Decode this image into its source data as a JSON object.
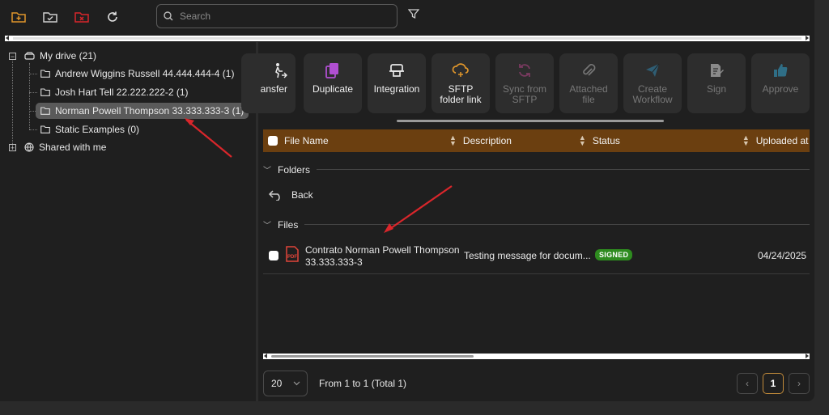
{
  "toolbar": {
    "icons": [
      "new-folder-icon",
      "folder-check-icon",
      "folder-x-icon",
      "refresh-icon"
    ],
    "search_placeholder": "Search",
    "filter_icon": "filter-icon"
  },
  "tree": {
    "root_label": "My drive (21)",
    "children": [
      {
        "label": "Andrew Wiggins Russell 44.444.444-4 (1)"
      },
      {
        "label": "Josh Hart Tell 22.222.222-2 (1)"
      },
      {
        "label": "Norman Powell Thompson 33.333.333-3 (1)",
        "selected": true
      },
      {
        "label": "Static Examples (0)"
      }
    ],
    "shared_label": "Shared with me"
  },
  "actions": [
    {
      "label": "ansfer",
      "icon": "transfer-icon",
      "disabled": false
    },
    {
      "label": "Duplicate",
      "icon": "duplicate-icon",
      "disabled": false
    },
    {
      "label": "Integration",
      "icon": "integration-icon",
      "disabled": false
    },
    {
      "label": "SFTP folder link",
      "icon": "sftp-link-icon",
      "disabled": false
    },
    {
      "label": "Sync from SFTP",
      "icon": "sync-icon",
      "disabled": true
    },
    {
      "label": "Attached file",
      "icon": "paperclip-icon",
      "disabled": true
    },
    {
      "label": "Create Workflow",
      "icon": "send-icon",
      "disabled": true
    },
    {
      "label": "Sign",
      "icon": "sign-icon",
      "disabled": true
    },
    {
      "label": "Approve",
      "icon": "thumbs-up-icon",
      "disabled": true
    }
  ],
  "table": {
    "columns": [
      "File Name",
      "Description",
      "Status",
      "Uploaded at"
    ],
    "folders_label": "Folders",
    "back_label": "Back",
    "files_label": "Files",
    "rows": [
      {
        "name_line1": "Contrato Norman Powell Thompson",
        "name_line2": "33.333.333-3",
        "description": "Testing message for docum...",
        "status": "SIGNED",
        "uploaded_at": "04/24/2025"
      }
    ]
  },
  "pagination": {
    "page_size": "20",
    "summary": "From 1 to 1 (Total 1)",
    "current_page": "1"
  },
  "colors": {
    "accent": "#e0962b",
    "header": "#6b3f10",
    "badge": "#2e8b1f",
    "annotation": "#d9262b"
  }
}
